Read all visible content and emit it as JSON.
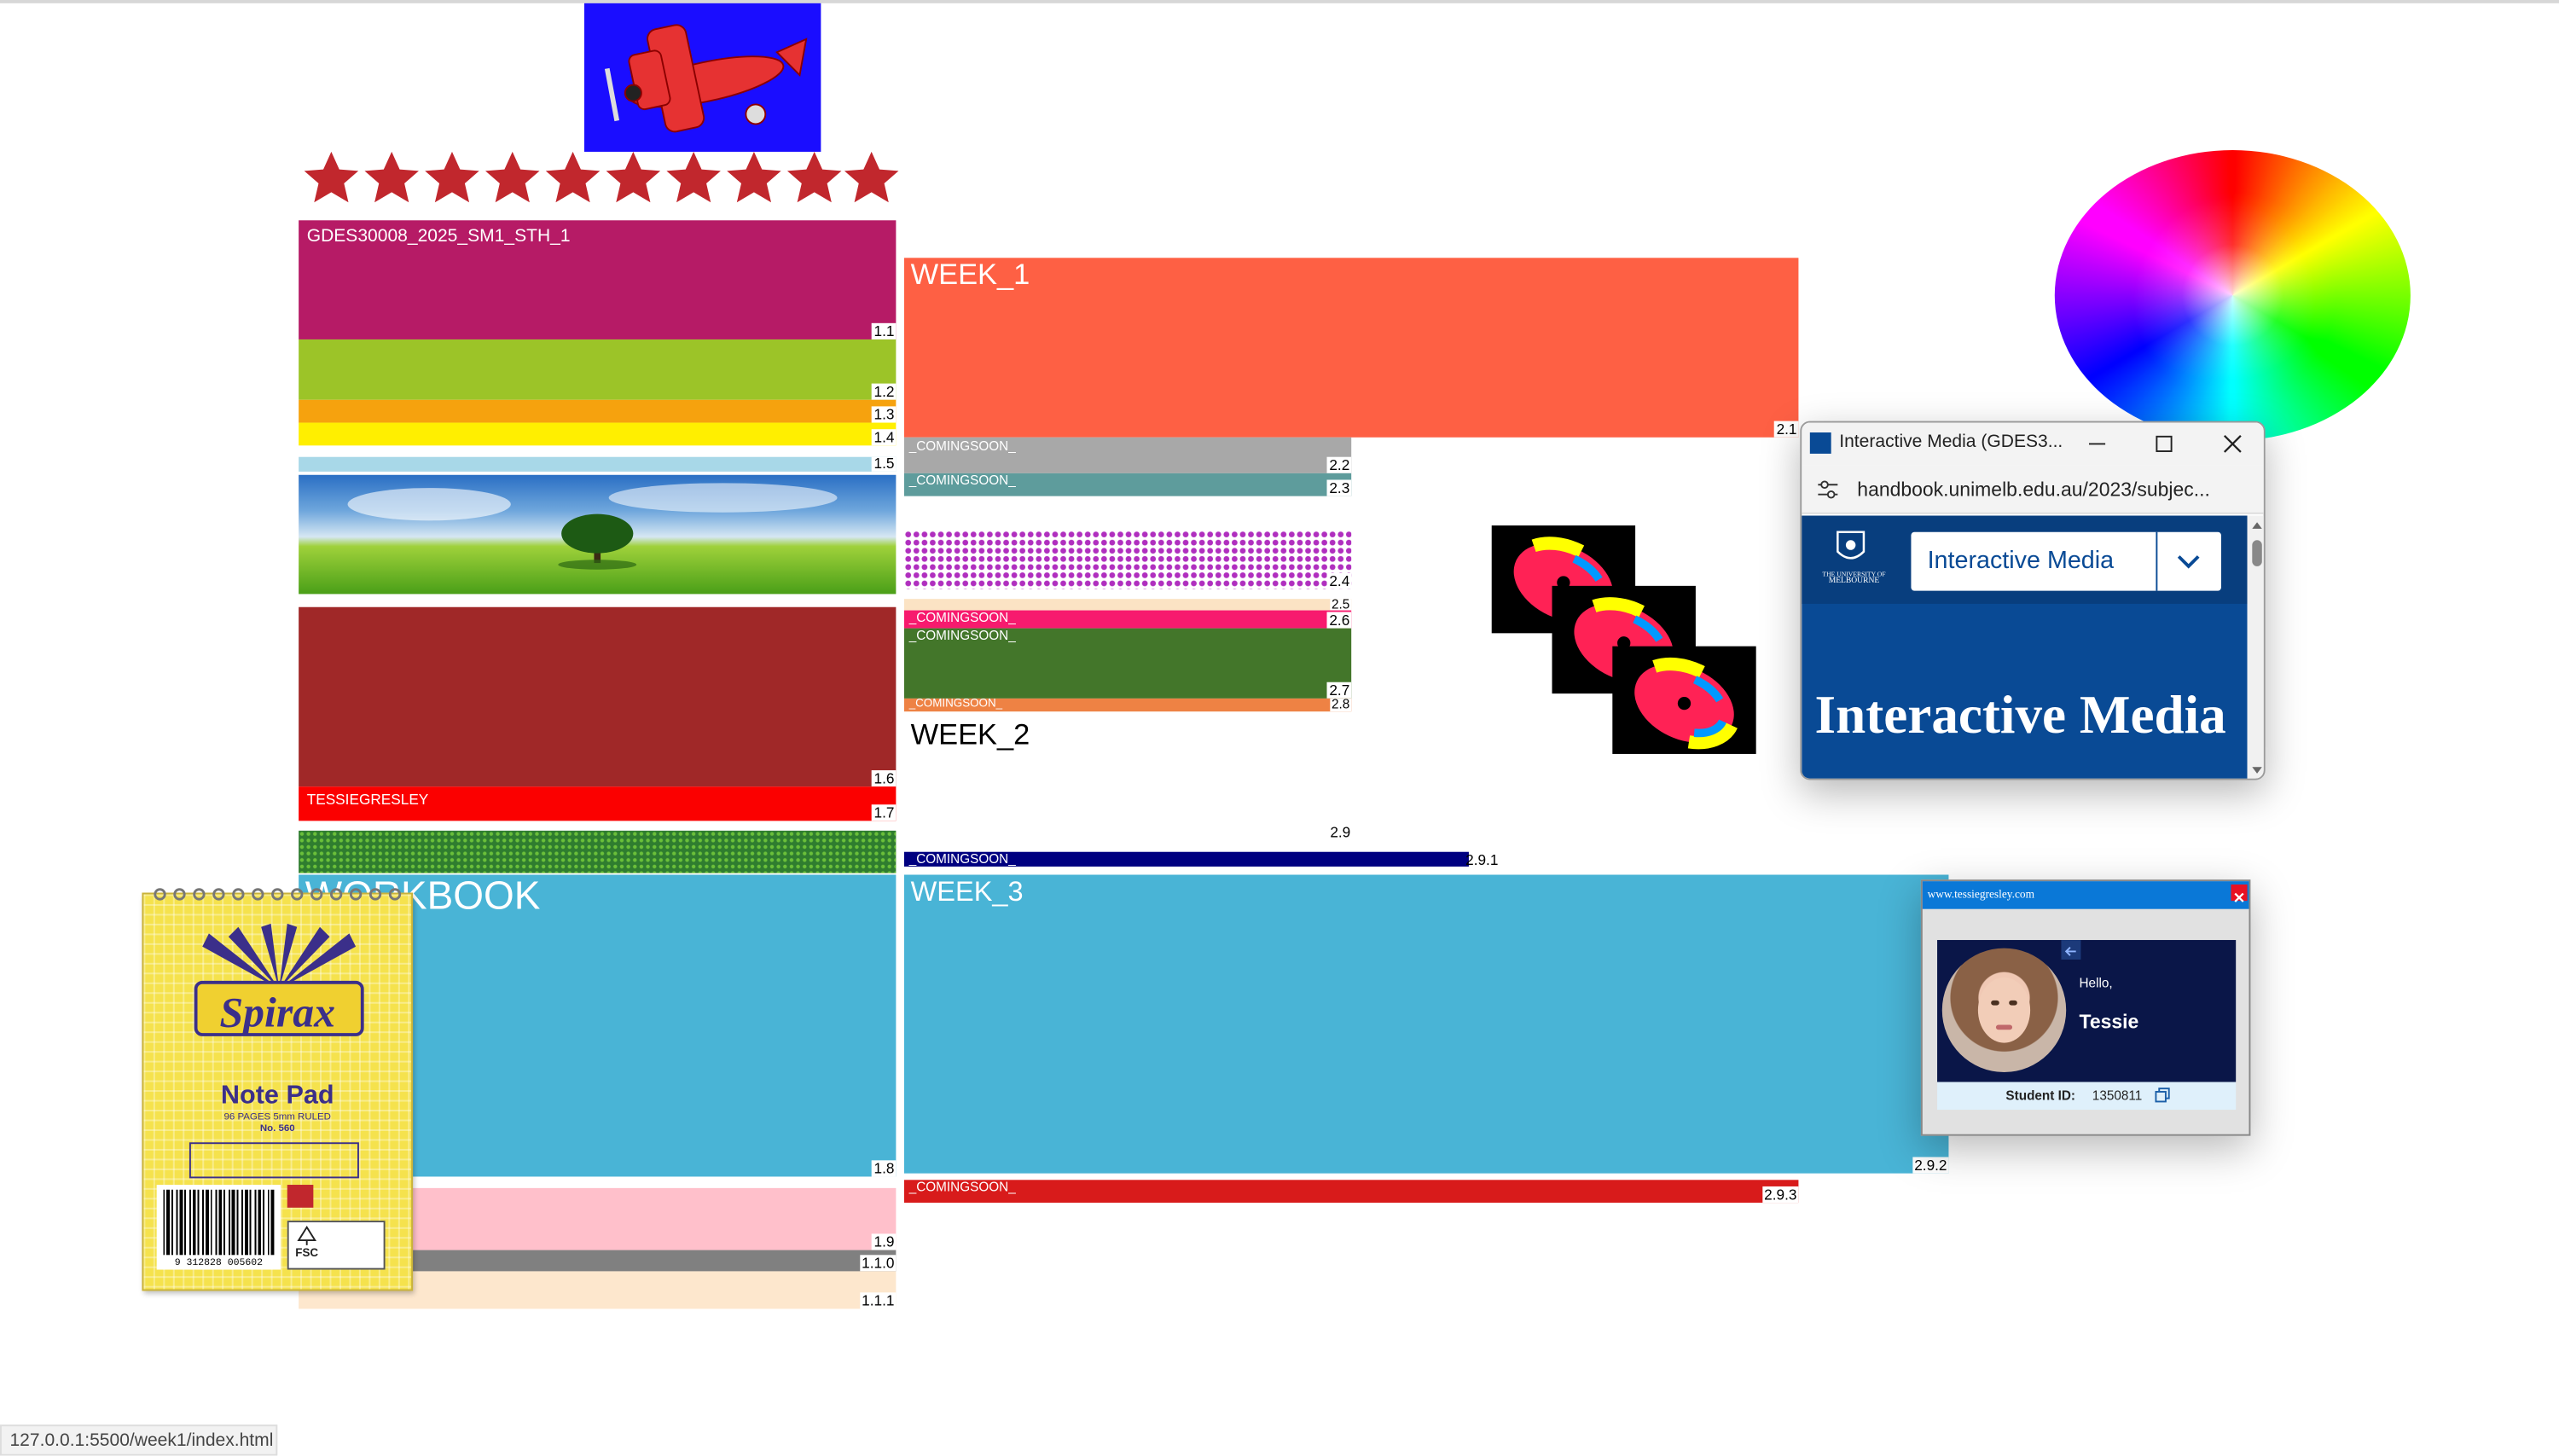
{
  "window": {
    "status_url": "127.0.0.1:5500/week1/index.html"
  },
  "colors": {
    "accent_red": "#c1272d",
    "uni_blue": "#094a95"
  },
  "course": {
    "code_label": "GDES30008_2025_SM1_STH_1",
    "name_label": "TESSIEGRESLEY",
    "workbook_title": "WORKBOOK"
  },
  "numbers": {
    "n1_1": "1.1",
    "n1_2": "1.2",
    "n1_3": "1.3",
    "n1_4": "1.4",
    "n1_5": "1.5",
    "n1_6": "1.6",
    "n1_7": "1.7",
    "n1_8": "1.8",
    "n1_9": "1.9",
    "n1_10": "1.1.0",
    "n1_11": "1.1.1",
    "n2_1": "2.1",
    "n2_2": "2.2",
    "n2_3": "2.3",
    "n2_4": "2.4",
    "n2_5": "2.5",
    "n2_6": "2.6",
    "n2_7": "2.7",
    "n2_8": "2.8",
    "n2_9": "2.9",
    "n2_9_1": "2.9.1",
    "n2_9_2": "2.9.2",
    "n2_9_3": "2.9.3"
  },
  "weeks": {
    "week1": "WEEK_1",
    "week2": "WEEK_2",
    "week3": "WEEK_3"
  },
  "coming_soon": "_COMINGSOON_",
  "notepad": {
    "brand": "Spirax",
    "title": "Note Pad",
    "pages": "96 PAGES 5mm RULED",
    "model": "No. 560",
    "barcode_digits": "9 312828 005602",
    "fsc": "FSC"
  },
  "browser_popup": {
    "tab_title": "Interactive Media (GDES3...",
    "url": "handbook.unimelb.edu.au/2023/subjec...",
    "dropdown_value": "Interactive Media",
    "heading": "Interactive Media",
    "uni_name_top": "THE UNIVERSITY OF",
    "uni_name_bottom": "MELBOURNE"
  },
  "profile_popup": {
    "url": "www.tessiegresley.com",
    "greeting": "Hello,",
    "name": "Tessie",
    "student_id_label": "Student ID:",
    "student_id_value": "1350811"
  },
  "icons": [
    "airplane-icon",
    "star-icon",
    "tune-icon",
    "chevron-down-icon",
    "minimize-icon",
    "maximize-icon",
    "close-icon",
    "copy-icon",
    "back-arrow-icon",
    "color-wheel-icon",
    "cd-icon"
  ]
}
